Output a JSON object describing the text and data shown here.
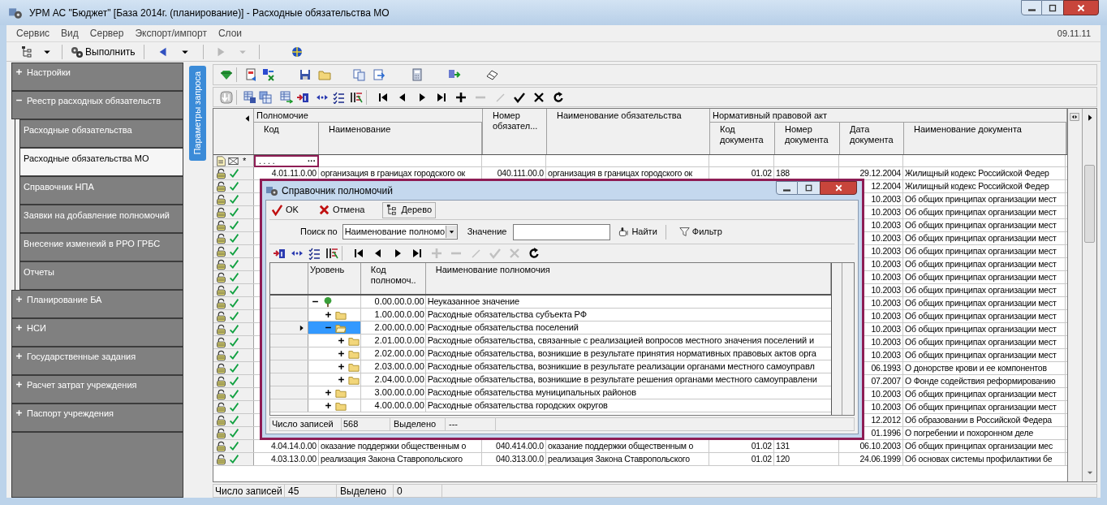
{
  "window": {
    "title": "УРМ АС \"Бюджет\" [База 2014г. (планирование)] - Расходные обязательства МО"
  },
  "menu": [
    "Сервис",
    "Вид",
    "Сервер",
    "Экспорт/импорт",
    "Слои"
  ],
  "date": "09.11.11",
  "toolbar": {
    "run_label": "Выполнить"
  },
  "sidebar": {
    "items": [
      {
        "label": "Настройки",
        "expanded": false
      },
      {
        "label": "Реестр расходных обязательств",
        "expanded": true,
        "children": [
          {
            "label": "Расходные обязательства",
            "selected": false
          },
          {
            "label": "Расходные обязательства МО",
            "selected": true
          },
          {
            "label": "Справочник НПА",
            "selected": false
          },
          {
            "label": "Заявки на добавление полномочий",
            "selected": false
          },
          {
            "label": "Внесение изменеий в РРО ГРБС",
            "selected": false
          },
          {
            "label": "Отчеты",
            "selected": false
          }
        ]
      },
      {
        "label": "Планирование БА",
        "expanded": false
      },
      {
        "label": "НСИ",
        "expanded": false
      },
      {
        "label": "Государственные задания",
        "expanded": false
      },
      {
        "label": "Расчет затрат учреждения",
        "expanded": false
      },
      {
        "label": "Паспорт учреждения",
        "expanded": false
      }
    ]
  },
  "query_tab": "Параметры запроса",
  "nav": [
    {
      "kind": "first",
      "disabled": false
    },
    {
      "kind": "prev",
      "disabled": false
    },
    {
      "kind": "next",
      "disabled": false
    },
    {
      "kind": "last",
      "disabled": false
    },
    {
      "kind": "plus",
      "disabled": false
    },
    {
      "kind": "minus",
      "disabled": true
    },
    {
      "kind": "pencil",
      "disabled": true
    },
    {
      "kind": "check",
      "disabled": false
    },
    {
      "kind": "close",
      "disabled": false
    },
    {
      "kind": "refresh",
      "disabled": false
    }
  ],
  "grid": {
    "header": [
      {
        "label": "Полномочие",
        "columns": [
          "Код",
          "Наименование"
        ]
      },
      {
        "columns": [
          "Номер обязател..."
        ]
      },
      {
        "columns": [
          "Наименование обязательства"
        ]
      },
      {
        "label": "Нормативный правовой акт",
        "columns": [
          "Код документа",
          "Номер документа",
          "Дата документа",
          "Наименование документа"
        ]
      }
    ],
    "new_row": {
      "marker": "*",
      "mask": ". .  .  .",
      "button": "···"
    },
    "rows": [
      {
        "cells": [
          "4.01.11.0.00",
          "организация в границах городского ок",
          "040.111.00.0",
          "организация в границах городского ок",
          "01.02",
          "188",
          "29.12.2004",
          "Жилищный кодекс Российской Федер"
        ]
      },
      {
        "cells": [
          "12.2004",
          "Жилищный кодекс Российской Федер"
        ]
      },
      {
        "cells": [
          "10.2003",
          "Об общих принципах организации мест"
        ]
      },
      {
        "cells": [
          "10.2003",
          "Об общих принципах организации мест"
        ]
      },
      {
        "cells": [
          "10.2003",
          "Об общих принципах организации мест"
        ]
      },
      {
        "cells": [
          "10.2003",
          "Об общих принципах организации мест"
        ]
      },
      {
        "cells": [
          "10.2003",
          "Об общих принципах организации мест"
        ]
      },
      {
        "cells": [
          "10.2003",
          "Об общих принципах организации мест"
        ]
      },
      {
        "cells": [
          "10.2003",
          "Об общих принципах организации мест"
        ]
      },
      {
        "cells": [
          "10.2003",
          "Об общих принципах организации мест"
        ]
      },
      {
        "cells": [
          "10.2003",
          "Об общих принципах организации мест"
        ]
      },
      {
        "cells": [
          "10.2003",
          "Об общих принципах организации мест"
        ]
      },
      {
        "cells": [
          "10.2003",
          "Об общих принципах организации мест"
        ]
      },
      {
        "cells": [
          "10.2003",
          "Об общих принципах организации мест"
        ]
      },
      {
        "cells": [
          "10.2003",
          "Об общих принципах организации мест"
        ]
      },
      {
        "cells": [
          "06.1993",
          "О донорстве крови и ее компонентов"
        ]
      },
      {
        "cells": [
          "07.2007",
          "О Фонде содействия реформированию"
        ]
      },
      {
        "cells": [
          "10.2003",
          "Об общих принципах организации мест"
        ]
      },
      {
        "cells": [
          "10.2003",
          "Об общих принципах организации мест"
        ]
      },
      {
        "cells": [
          "12.2012",
          "Об образовании в Российской Федера"
        ]
      },
      {
        "cells": [
          "01.1996",
          "О погребении и похоронном деле"
        ]
      },
      {
        "cells": [
          "4.04.14.0.00",
          "оказание поддержки общественным о",
          "040.414.00.0",
          "оказание поддержки общественным о",
          "01.02",
          "131",
          "06.10.2003",
          "Об общих принципах организации мес"
        ]
      },
      {
        "cells": [
          "4.03.13.0.00",
          "реализация Закона Ставропольского",
          "040.313.00.0",
          "реализация Закона Ставропольского",
          "01.02",
          "120",
          "24.06.1999",
          "Об основах системы профилактики бе"
        ]
      }
    ]
  },
  "status": {
    "count_label": "Число записей",
    "count": "45",
    "selected_label": "Выделено",
    "selected_count": "0"
  },
  "dialog": {
    "title": "Справочник полномочий",
    "buttons": [
      {
        "kind": "ok",
        "label": "OK"
      },
      {
        "kind": "cancel",
        "label": "Отмена"
      },
      {
        "kind": "tree",
        "label": "Дерево"
      }
    ],
    "search_label": "Поиск по",
    "search_by": "Наименование полномо",
    "value_label": "Значение",
    "find": "Найти",
    "filter": "Фильтр",
    "nav": [
      {
        "kind": "first",
        "disabled": false
      },
      {
        "kind": "prev",
        "disabled": false
      },
      {
        "kind": "next",
        "disabled": false
      },
      {
        "kind": "last",
        "disabled": false
      },
      {
        "kind": "plus",
        "disabled": true
      },
      {
        "kind": "minus",
        "disabled": true
      },
      {
        "kind": "pencil",
        "disabled": true
      },
      {
        "kind": "check",
        "disabled": true
      },
      {
        "kind": "close",
        "disabled": true
      },
      {
        "kind": "refresh",
        "disabled": false
      }
    ],
    "columns": [
      "Уровень",
      "Код полномоч..",
      "Наименование полномочия"
    ],
    "tree": [
      {
        "kind": "root",
        "code": "0.00.00.0.00",
        "name": "Неуказанное значение",
        "expanded": true,
        "selected": false,
        "children": [
          {
            "kind": "folder",
            "code": "1.00.00.0.00",
            "name": "Расходные обязательства субъекта РФ",
            "expanded": false,
            "selected": false
          },
          {
            "kind": "folder",
            "code": "2.00.00.0.00",
            "name": "Расходные обязательства поселений",
            "expanded": true,
            "selected": true,
            "children": [
              {
                "kind": "folder",
                "code": "2.01.00.0.00",
                "name": "Расходные обязательства, связанные с реализацией вопросов местного значения поселений и",
                "expanded": false,
                "selected": false
              },
              {
                "kind": "folder",
                "code": "2.02.00.0.00",
                "name": "Расходные обязательства, возникшие в результате принятия нормативных правовых актов орга",
                "expanded": false,
                "selected": false
              },
              {
                "kind": "folder",
                "code": "2.03.00.0.00",
                "name": "Расходные обязательства, возникшие в результате реализации органами местного самоуправл",
                "expanded": false,
                "selected": false
              },
              {
                "kind": "folder",
                "code": "2.04.00.0.00",
                "name": "Расходные обязательства, возникшие в результате решения органами местного самоуправлени",
                "expanded": false,
                "selected": false
              }
            ]
          },
          {
            "kind": "folder",
            "code": "3.00.00.0.00",
            "name": "Расходные обязательства муниципальных районов",
            "expanded": false,
            "selected": false
          },
          {
            "kind": "folder",
            "code": "4.00.00.0.00",
            "name": "Расходные обязательства городских округов",
            "expanded": false,
            "selected": false
          }
        ]
      }
    ],
    "status": {
      "count_label": "Число записей",
      "count": "568",
      "selected_label": "Выделено",
      "selected_count": "---"
    }
  }
}
